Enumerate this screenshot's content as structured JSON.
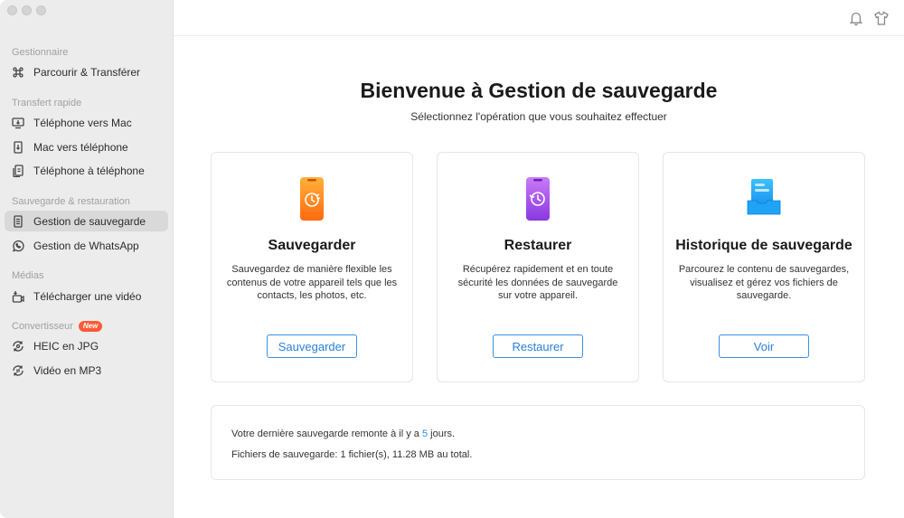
{
  "sidebar": {
    "sections": [
      {
        "label": "Gestionnaire"
      },
      {
        "label": "Transfert rapide"
      },
      {
        "label": "Sauvegarde & restauration"
      },
      {
        "label": "Médias"
      },
      {
        "label": "Convertisseur",
        "badge": "New"
      }
    ],
    "items": [
      {
        "label": "Parcourir & Transférer",
        "icon": "command-icon"
      },
      {
        "label": "Téléphone vers Mac",
        "icon": "phone-to-mac-icon"
      },
      {
        "label": "Mac vers téléphone",
        "icon": "mac-to-phone-icon"
      },
      {
        "label": "Téléphone à téléphone",
        "icon": "phone-to-phone-icon"
      },
      {
        "label": "Gestion de sauvegarde",
        "icon": "backup-icon",
        "active": true
      },
      {
        "label": "Gestion de WhatsApp",
        "icon": "whatsapp-icon"
      },
      {
        "label": "Télécharger une vidéo",
        "icon": "download-video-icon"
      },
      {
        "label": "HEIC en JPG",
        "icon": "convert-image-icon"
      },
      {
        "label": "Vidéo en MP3",
        "icon": "convert-audio-icon"
      }
    ]
  },
  "topbar": {
    "icons": [
      "bell-icon",
      "tshirt-icon"
    ]
  },
  "main": {
    "title": "Bienvenue à Gestion de sauvegarde",
    "subtitle": "Sélectionnez l'opération que vous souhaitez effectuer",
    "cards": [
      {
        "title": "Sauvegarder",
        "desc": "Sauvegardez de manière flexible les contenus de votre appareil tels que les contacts, les photos, etc.",
        "button": "Sauvegarder",
        "icon": "backup-phone-icon",
        "color": "#ff7a1a"
      },
      {
        "title": "Restaurer",
        "desc": "Récupérez rapidement et en toute sécurité les données de sauvegarde sur votre appareil.",
        "button": "Restaurer",
        "icon": "restore-phone-icon",
        "color": "#a24fe6"
      },
      {
        "title": "Historique de sauvegarde",
        "desc": "Parcourez le contenu de sauvegardes, visualisez et gérez vos fichiers de sauvegarde.",
        "button": "Voir",
        "icon": "history-icon",
        "color": "#1a9bf0"
      }
    ],
    "info": {
      "last_backup_prefix": "Votre dernière sauvegarde remonte à il y a ",
      "last_backup_days": "5",
      "last_backup_suffix": " jours.",
      "files": "Fichiers de sauvegarde: 1 fichier(s), 11.28 MB au total."
    }
  },
  "colors": {
    "accent": "#2a7fd8",
    "sidebar_bg": "#ececec",
    "new_badge": "#ff5a36"
  }
}
